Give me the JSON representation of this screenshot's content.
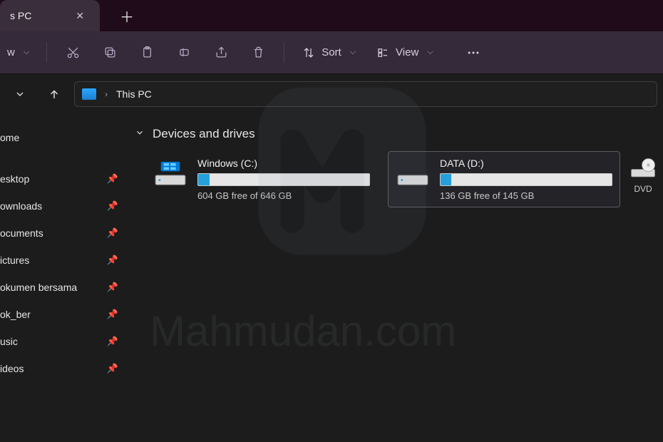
{
  "tab": {
    "title": "s PC"
  },
  "toolbar": {
    "new_label": "w",
    "sort_label": "Sort",
    "view_label": "View"
  },
  "breadcrumb": {
    "location": "This PC"
  },
  "sidebar": {
    "items": [
      {
        "label": "ome",
        "pinned": false
      },
      {
        "label": "esktop",
        "pinned": true
      },
      {
        "label": "ownloads",
        "pinned": true
      },
      {
        "label": "ocuments",
        "pinned": true
      },
      {
        "label": "ictures",
        "pinned": true
      },
      {
        "label": "okumen bersama",
        "pinned": true
      },
      {
        "label": "ok_ber",
        "pinned": true
      },
      {
        "label": "usic",
        "pinned": true
      },
      {
        "label": "ideos",
        "pinned": true
      }
    ]
  },
  "section": {
    "title": "Devices and drives"
  },
  "drives": [
    {
      "name": "Windows (C:)",
      "free_text": "604 GB free of 646 GB",
      "used_pct": 6.5,
      "os": true,
      "selected": false
    },
    {
      "name": "DATA (D:)",
      "free_text": "136 GB free of 145 GB",
      "used_pct": 6.2,
      "os": false,
      "selected": true
    }
  ],
  "dvd": {
    "label": "DVD"
  },
  "watermark": "Mahmudan.com"
}
